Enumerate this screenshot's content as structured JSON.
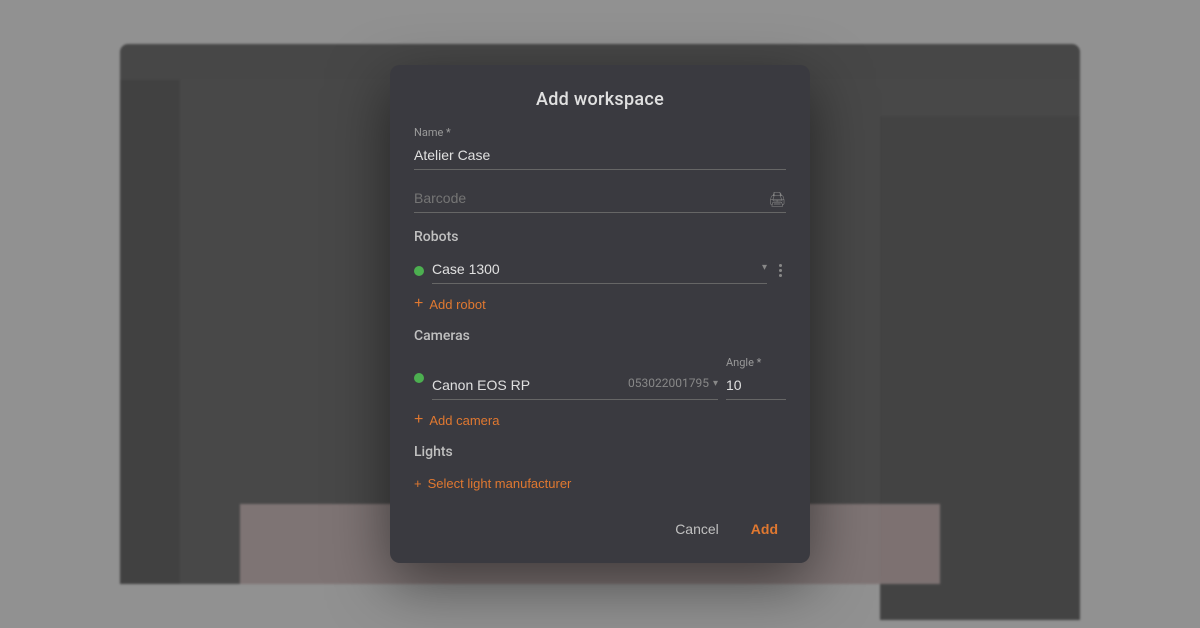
{
  "modal": {
    "title": "Add workspace",
    "name_label": "Name *",
    "name_value": "Atelier Case",
    "barcode_placeholder": "Barcode",
    "robots_section": "Robots",
    "robot_name": "Case 1300",
    "add_robot_label": "Add robot",
    "cameras_section": "Cameras",
    "camera_name": "Canon EOS RP",
    "camera_serial": "053022001795",
    "angle_label": "Angle *",
    "angle_value": "10",
    "add_camera_label": "Add camera",
    "lights_section": "Lights",
    "select_light_label": "Select light manufacturer",
    "cancel_label": "Cancel",
    "add_label": "Add"
  },
  "icons": {
    "print": "🖨",
    "plus": "+",
    "chevron_down": "▾",
    "dots_vertical": "⋮"
  }
}
